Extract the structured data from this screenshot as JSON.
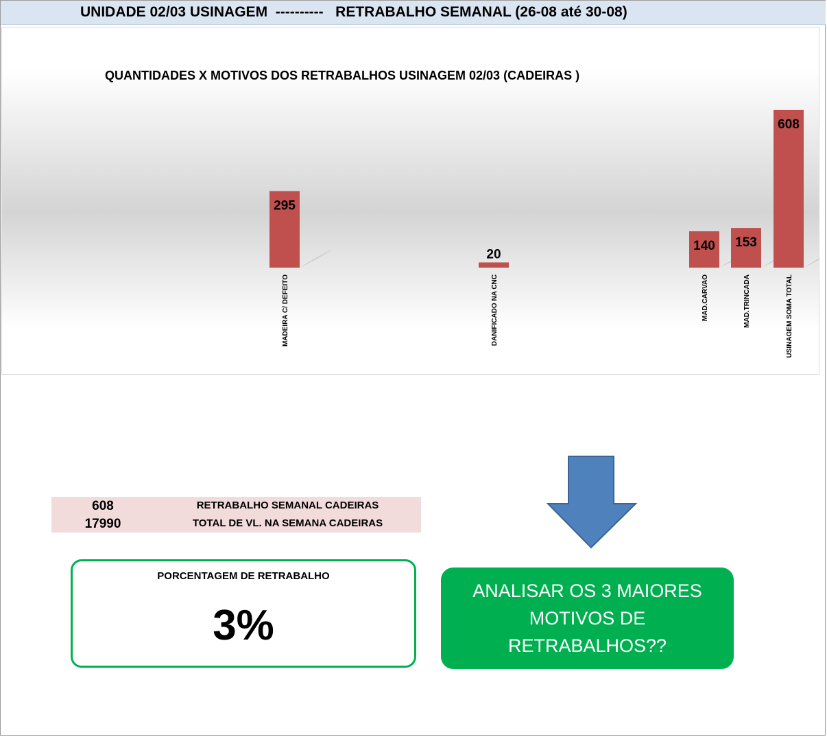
{
  "header": {
    "title": "UNIDADE 02/03 USINAGEM  ----------   RETRABALHO SEMANAL (26-08 até 30-08)"
  },
  "chart_data": {
    "type": "bar",
    "title": "QUANTIDADES X MOTIVOS DOS RETRABALHOS USINAGEM 02/03 (CADEIRAS )",
    "categories": [
      "MADEIRA C/ DEFEITO",
      "DANIFICADO NA CNC",
      "MAD.CARVAO",
      "MAD.TRINCADA",
      "USINAGEM SOMA TOTAL"
    ],
    "values": [
      295,
      20,
      140,
      153,
      608
    ],
    "data_labels": [
      "295",
      "20",
      "140",
      "153",
      "608"
    ],
    "ylim": [
      0,
      700
    ],
    "grid": false,
    "legend": false,
    "xlabel": "",
    "ylabel": "",
    "bar_color": "#c0504d"
  },
  "summary": {
    "rows": [
      {
        "value": "608",
        "label": "RETRABALHO SEMANAL CADEIRAS"
      },
      {
        "value": "17990",
        "label": "TOTAL DE VL. NA SEMANA CADEIRAS"
      }
    ]
  },
  "percentage": {
    "label": "PORCENTAGEM DE RETRABALHO",
    "value": "3%"
  },
  "arrow": {
    "icon": "arrow-down-icon",
    "color": "#4f81bd"
  },
  "callout": {
    "text": "ANALISAR OS 3 MAIORES MOTIVOS DE RETRABALHOS??",
    "color": "#00b050"
  }
}
